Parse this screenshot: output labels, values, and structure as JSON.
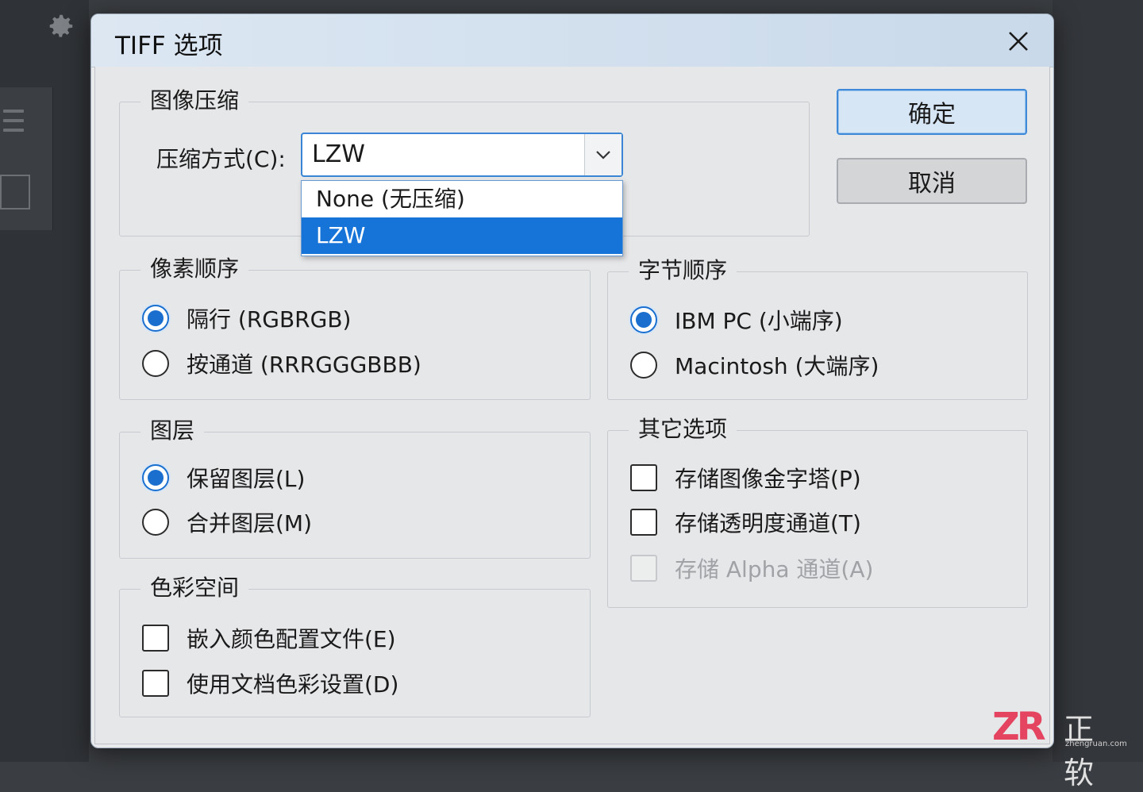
{
  "dialog": {
    "title": "TIFF 选项",
    "ok_label": "确定",
    "cancel_label": "取消"
  },
  "compression": {
    "group_label": "图像压缩",
    "field_label": "压缩方式(C):",
    "selected_value": "LZW",
    "options": [
      "None (无压缩)",
      "LZW"
    ],
    "highlighted_option": "LZW"
  },
  "pixel_order": {
    "group_label": "像素顺序",
    "options": [
      {
        "label": "隔行 (RGBRGB)",
        "selected": true
      },
      {
        "label": "按通道 (RRRGGGBBB)",
        "selected": false
      }
    ]
  },
  "byte_order": {
    "group_label": "字节顺序",
    "options": [
      {
        "label": "IBM PC (小端序)",
        "selected": true
      },
      {
        "label": "Macintosh (大端序)",
        "selected": false
      }
    ]
  },
  "layers": {
    "group_label": "图层",
    "options": [
      {
        "label": "保留图层(L)",
        "selected": true
      },
      {
        "label": "合并图层(M)",
        "selected": false
      }
    ]
  },
  "other_options": {
    "group_label": "其它选项",
    "items": [
      {
        "label": "存储图像金字塔(P)",
        "checked": false,
        "enabled": true
      },
      {
        "label": "存储透明度通道(T)",
        "checked": false,
        "enabled": true
      },
      {
        "label": "存储 Alpha 通道(A)",
        "checked": false,
        "enabled": false
      }
    ]
  },
  "color_space": {
    "group_label": "色彩空间",
    "items": [
      {
        "label": "嵌入颜色配置文件(E)",
        "checked": false
      },
      {
        "label": "使用文档色彩设置(D)",
        "checked": false
      }
    ]
  },
  "watermark": {
    "logo": "ZR",
    "name": "正软",
    "url": "zhengruan.com"
  },
  "colors": {
    "accent": "#1a6fce",
    "selection": "#1673d8",
    "titlebar": "#d3e1ef"
  }
}
